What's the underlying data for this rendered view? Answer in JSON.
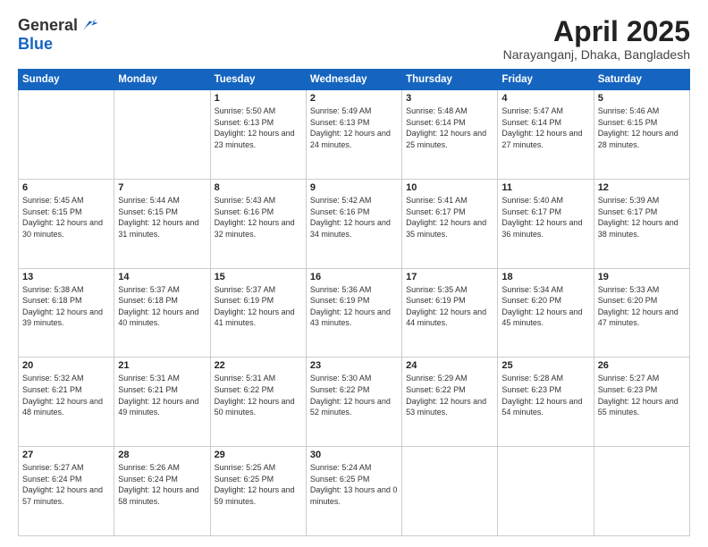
{
  "header": {
    "logo_line1": "General",
    "logo_line2": "Blue",
    "title": "April 2025",
    "subtitle": "Narayanganj, Dhaka, Bangladesh"
  },
  "columns": [
    "Sunday",
    "Monday",
    "Tuesday",
    "Wednesday",
    "Thursday",
    "Friday",
    "Saturday"
  ],
  "weeks": [
    [
      {
        "day": "",
        "info": ""
      },
      {
        "day": "",
        "info": ""
      },
      {
        "day": "1",
        "info": "Sunrise: 5:50 AM\nSunset: 6:13 PM\nDaylight: 12 hours and 23 minutes."
      },
      {
        "day": "2",
        "info": "Sunrise: 5:49 AM\nSunset: 6:13 PM\nDaylight: 12 hours and 24 minutes."
      },
      {
        "day": "3",
        "info": "Sunrise: 5:48 AM\nSunset: 6:14 PM\nDaylight: 12 hours and 25 minutes."
      },
      {
        "day": "4",
        "info": "Sunrise: 5:47 AM\nSunset: 6:14 PM\nDaylight: 12 hours and 27 minutes."
      },
      {
        "day": "5",
        "info": "Sunrise: 5:46 AM\nSunset: 6:15 PM\nDaylight: 12 hours and 28 minutes."
      }
    ],
    [
      {
        "day": "6",
        "info": "Sunrise: 5:45 AM\nSunset: 6:15 PM\nDaylight: 12 hours and 30 minutes."
      },
      {
        "day": "7",
        "info": "Sunrise: 5:44 AM\nSunset: 6:15 PM\nDaylight: 12 hours and 31 minutes."
      },
      {
        "day": "8",
        "info": "Sunrise: 5:43 AM\nSunset: 6:16 PM\nDaylight: 12 hours and 32 minutes."
      },
      {
        "day": "9",
        "info": "Sunrise: 5:42 AM\nSunset: 6:16 PM\nDaylight: 12 hours and 34 minutes."
      },
      {
        "day": "10",
        "info": "Sunrise: 5:41 AM\nSunset: 6:17 PM\nDaylight: 12 hours and 35 minutes."
      },
      {
        "day": "11",
        "info": "Sunrise: 5:40 AM\nSunset: 6:17 PM\nDaylight: 12 hours and 36 minutes."
      },
      {
        "day": "12",
        "info": "Sunrise: 5:39 AM\nSunset: 6:17 PM\nDaylight: 12 hours and 38 minutes."
      }
    ],
    [
      {
        "day": "13",
        "info": "Sunrise: 5:38 AM\nSunset: 6:18 PM\nDaylight: 12 hours and 39 minutes."
      },
      {
        "day": "14",
        "info": "Sunrise: 5:37 AM\nSunset: 6:18 PM\nDaylight: 12 hours and 40 minutes."
      },
      {
        "day": "15",
        "info": "Sunrise: 5:37 AM\nSunset: 6:19 PM\nDaylight: 12 hours and 41 minutes."
      },
      {
        "day": "16",
        "info": "Sunrise: 5:36 AM\nSunset: 6:19 PM\nDaylight: 12 hours and 43 minutes."
      },
      {
        "day": "17",
        "info": "Sunrise: 5:35 AM\nSunset: 6:19 PM\nDaylight: 12 hours and 44 minutes."
      },
      {
        "day": "18",
        "info": "Sunrise: 5:34 AM\nSunset: 6:20 PM\nDaylight: 12 hours and 45 minutes."
      },
      {
        "day": "19",
        "info": "Sunrise: 5:33 AM\nSunset: 6:20 PM\nDaylight: 12 hours and 47 minutes."
      }
    ],
    [
      {
        "day": "20",
        "info": "Sunrise: 5:32 AM\nSunset: 6:21 PM\nDaylight: 12 hours and 48 minutes."
      },
      {
        "day": "21",
        "info": "Sunrise: 5:31 AM\nSunset: 6:21 PM\nDaylight: 12 hours and 49 minutes."
      },
      {
        "day": "22",
        "info": "Sunrise: 5:31 AM\nSunset: 6:22 PM\nDaylight: 12 hours and 50 minutes."
      },
      {
        "day": "23",
        "info": "Sunrise: 5:30 AM\nSunset: 6:22 PM\nDaylight: 12 hours and 52 minutes."
      },
      {
        "day": "24",
        "info": "Sunrise: 5:29 AM\nSunset: 6:22 PM\nDaylight: 12 hours and 53 minutes."
      },
      {
        "day": "25",
        "info": "Sunrise: 5:28 AM\nSunset: 6:23 PM\nDaylight: 12 hours and 54 minutes."
      },
      {
        "day": "26",
        "info": "Sunrise: 5:27 AM\nSunset: 6:23 PM\nDaylight: 12 hours and 55 minutes."
      }
    ],
    [
      {
        "day": "27",
        "info": "Sunrise: 5:27 AM\nSunset: 6:24 PM\nDaylight: 12 hours and 57 minutes."
      },
      {
        "day": "28",
        "info": "Sunrise: 5:26 AM\nSunset: 6:24 PM\nDaylight: 12 hours and 58 minutes."
      },
      {
        "day": "29",
        "info": "Sunrise: 5:25 AM\nSunset: 6:25 PM\nDaylight: 12 hours and 59 minutes."
      },
      {
        "day": "30",
        "info": "Sunrise: 5:24 AM\nSunset: 6:25 PM\nDaylight: 13 hours and 0 minutes."
      },
      {
        "day": "",
        "info": ""
      },
      {
        "day": "",
        "info": ""
      },
      {
        "day": "",
        "info": ""
      }
    ]
  ]
}
